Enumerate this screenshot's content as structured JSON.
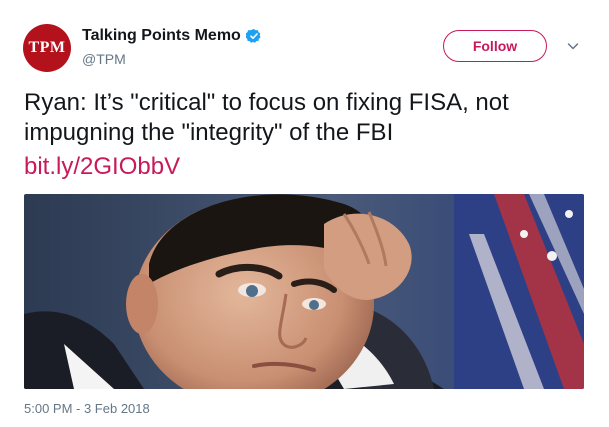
{
  "account": {
    "avatar_text": "TPM",
    "display_name": "Talking Points Memo",
    "handle": "@TPM",
    "verified": true,
    "avatar_color": "#b3121d"
  },
  "actions": {
    "follow_label": "Follow",
    "more_icon": "chevron-down-icon"
  },
  "tweet": {
    "text": "Ryan: It’s \"critical\" to focus on fixing FISA, not impugning the \"integrity\" of the FBI",
    "link": "bit.ly/2GIObbV",
    "timestamp": "5:00 PM - 3 Feb 2018"
  },
  "colors": {
    "accent": "#c8195a",
    "verified_blue": "#1da1f2",
    "muted_text": "#657786"
  }
}
